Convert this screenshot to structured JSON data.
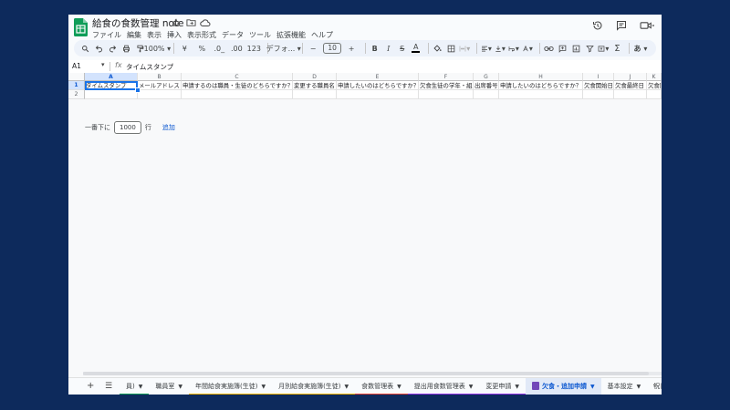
{
  "title": "給食の食数管理 note",
  "menu": [
    "ファイル",
    "編集",
    "表示",
    "挿入",
    "表示形式",
    "データ",
    "ツール",
    "拡張機能",
    "ヘルプ"
  ],
  "toolbar": {
    "zoom": "100%",
    "currency": "¥",
    "percent": "%",
    "dec_decrease": ".0_",
    "dec_increase": ".00",
    "number_format": "123",
    "font": "デフォ...",
    "font_size": "10",
    "ime": "あ"
  },
  "formula_bar": {
    "cell_ref": "A1",
    "fx": "fx",
    "value": "タイムスタンプ"
  },
  "columns": [
    "A",
    "B",
    "C",
    "D",
    "E",
    "F",
    "G",
    "H",
    "I",
    "J",
    "K"
  ],
  "rows": [
    "1",
    "2"
  ],
  "header_cells": [
    "タイムスタンプ",
    "メールアドレス",
    "申請するのは職員・生徒のどちらですか？",
    "変更する職員名",
    "申請したいのはどちらですか？",
    "欠食生徒の学年・組",
    "出席番号",
    "申請したいのはどちらですか？",
    "欠食開始日",
    "欠食最終日",
    "欠食開"
  ],
  "add_rows": {
    "prefix": "一番下に",
    "count": "1000",
    "unit": "行",
    "action": "追加"
  },
  "sheet_tabs": [
    {
      "label": "員)",
      "color": "#0f9d58"
    },
    {
      "label": "職員室",
      "color": ""
    },
    {
      "label": "年間給食実施簿(生徒)",
      "color": "#f4b400"
    },
    {
      "label": "月別給食実施簿(生徒)",
      "color": "#f4b400"
    },
    {
      "label": "食数管理表",
      "color": "#ea4335"
    },
    {
      "label": "提出用食数管理表",
      "color": "#9334e6"
    },
    {
      "label": "変更申請",
      "color": "#9334e6"
    },
    {
      "label": "欠食・追加申請",
      "color": "",
      "active": true,
      "form": true
    },
    {
      "label": "基本設定",
      "color": ""
    },
    {
      "label": "祝日リスト",
      "color": ""
    }
  ],
  "colors": {
    "background": "#0d2a5c",
    "accent": "#1a73e8",
    "sheets_green": "#0f9d58"
  }
}
